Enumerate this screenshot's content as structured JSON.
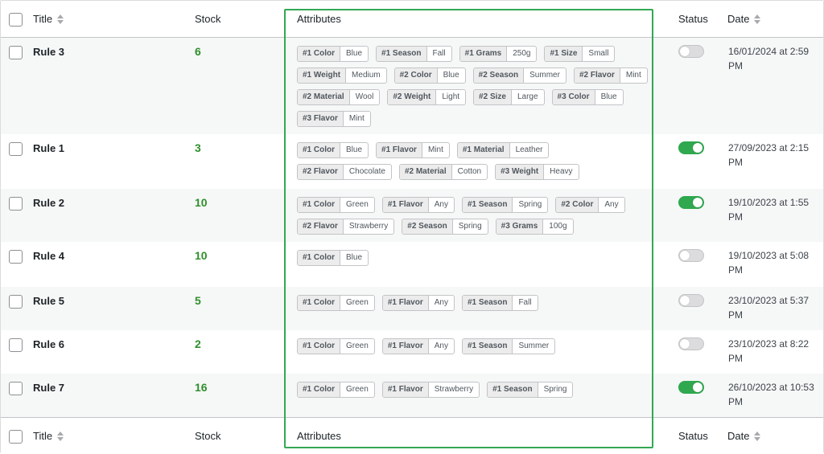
{
  "columns": {
    "title": "Title",
    "stock": "Stock",
    "attributes": "Attributes",
    "status": "Status",
    "date": "Date"
  },
  "rows": [
    {
      "title": "Rule 3",
      "stock": "6",
      "status": false,
      "date": "16/01/2024 at 2:59 PM",
      "attributes": [
        {
          "k": "#1 Color",
          "v": "Blue"
        },
        {
          "k": "#1 Season",
          "v": "Fall"
        },
        {
          "k": "#1 Grams",
          "v": "250g"
        },
        {
          "k": "#1 Size",
          "v": "Small"
        },
        {
          "k": "#1 Weight",
          "v": "Medium"
        },
        {
          "k": "#2 Color",
          "v": "Blue"
        },
        {
          "k": "#2 Season",
          "v": "Summer"
        },
        {
          "k": "#2 Flavor",
          "v": "Mint"
        },
        {
          "k": "#2 Material",
          "v": "Wool"
        },
        {
          "k": "#2 Weight",
          "v": "Light"
        },
        {
          "k": "#2 Size",
          "v": "Large"
        },
        {
          "k": "#3 Color",
          "v": "Blue"
        },
        {
          "k": "#3 Flavor",
          "v": "Mint"
        }
      ]
    },
    {
      "title": "Rule 1",
      "stock": "3",
      "status": true,
      "date": "27/09/2023 at 2:15 PM",
      "attributes": [
        {
          "k": "#1 Color",
          "v": "Blue"
        },
        {
          "k": "#1 Flavor",
          "v": "Mint"
        },
        {
          "k": "#1 Material",
          "v": "Leather"
        },
        {
          "k": "#2 Flavor",
          "v": "Chocolate"
        },
        {
          "k": "#2 Material",
          "v": "Cotton"
        },
        {
          "k": "#3 Weight",
          "v": "Heavy"
        }
      ]
    },
    {
      "title": "Rule 2",
      "stock": "10",
      "status": true,
      "date": "19/10/2023 at 1:55 PM",
      "attributes": [
        {
          "k": "#1 Color",
          "v": "Green"
        },
        {
          "k": "#1 Flavor",
          "v": "Any"
        },
        {
          "k": "#1 Season",
          "v": "Spring"
        },
        {
          "k": "#2 Color",
          "v": "Any"
        },
        {
          "k": "#2 Flavor",
          "v": "Strawberry"
        },
        {
          "k": "#2 Season",
          "v": "Spring"
        },
        {
          "k": "#3 Grams",
          "v": "100g"
        }
      ]
    },
    {
      "title": "Rule 4",
      "stock": "10",
      "status": false,
      "date": "19/10/2023 at 5:08 PM",
      "attributes": [
        {
          "k": "#1 Color",
          "v": "Blue"
        }
      ]
    },
    {
      "title": "Rule 5",
      "stock": "5",
      "status": false,
      "date": "23/10/2023 at 5:37 PM",
      "attributes": [
        {
          "k": "#1 Color",
          "v": "Green"
        },
        {
          "k": "#1 Flavor",
          "v": "Any"
        },
        {
          "k": "#1 Season",
          "v": "Fall"
        }
      ]
    },
    {
      "title": "Rule 6",
      "stock": "2",
      "status": false,
      "date": "23/10/2023 at 8:22 PM",
      "attributes": [
        {
          "k": "#1 Color",
          "v": "Green"
        },
        {
          "k": "#1 Flavor",
          "v": "Any"
        },
        {
          "k": "#1 Season",
          "v": "Summer"
        }
      ]
    },
    {
      "title": "Rule 7",
      "stock": "16",
      "status": true,
      "date": "26/10/2023 at 10:53 PM",
      "attributes": [
        {
          "k": "#1 Color",
          "v": "Green"
        },
        {
          "k": "#1 Flavor",
          "v": "Strawberry"
        },
        {
          "k": "#1 Season",
          "v": "Spring"
        }
      ]
    }
  ],
  "colors": {
    "stock": "#2f8f2b",
    "toggle_on": "#2fa84f",
    "highlight": "#33a853"
  }
}
